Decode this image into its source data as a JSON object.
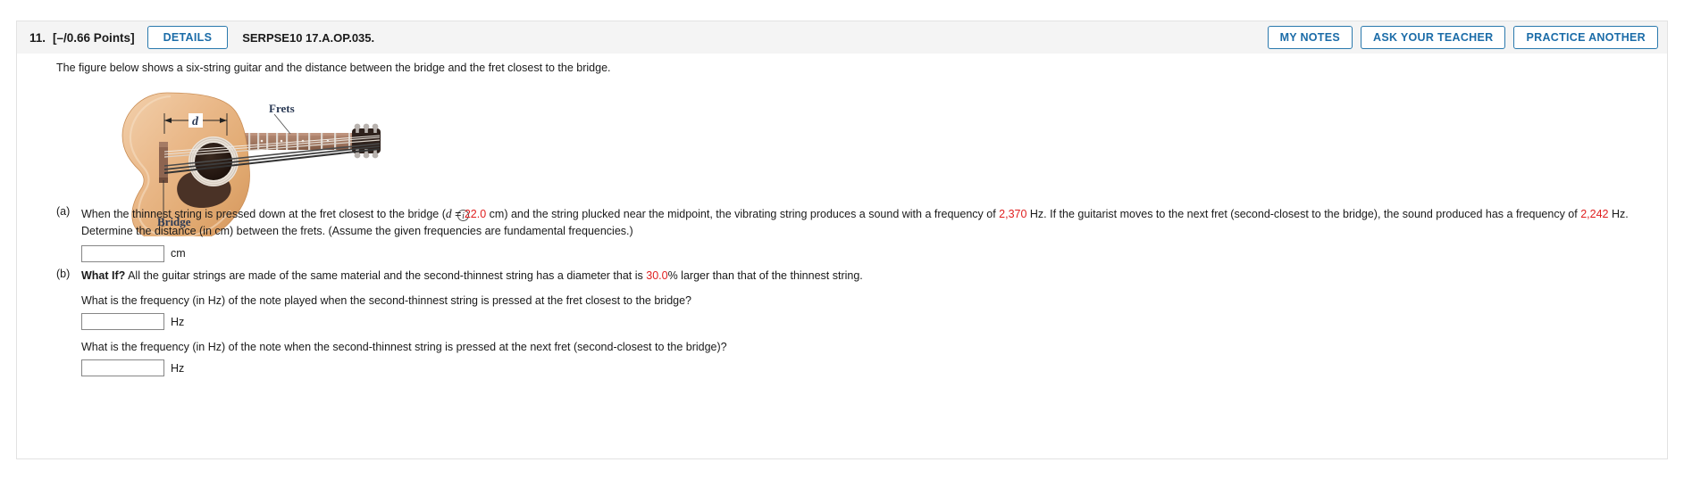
{
  "header": {
    "question_number": "11.",
    "points": "[–/0.66 Points]",
    "details_label": "DETAILS",
    "question_code": "SERPSE10 17.A.OP.035.",
    "my_notes_label": "MY NOTES",
    "ask_teacher_label": "ASK YOUR TEACHER",
    "practice_another_label": "PRACTICE ANOTHER"
  },
  "stem": "The figure below shows a six-string guitar and the distance between the bridge and the fret closest to the bridge.",
  "figure": {
    "label_frets": "Frets",
    "label_bridge": "Bridge",
    "label_d": "d",
    "info_icon": "i"
  },
  "parts": {
    "a": {
      "tag": "(a)",
      "text_1": "When the thinnest string is pressed down at the fret closest to the bridge (",
      "var_d": "d",
      "eq": " = ",
      "d_value": "22.0",
      "text_2": " cm) and the string plucked near the midpoint, the vibrating string produces a sound with a frequency of ",
      "freq_1": "2,370",
      "text_3": " Hz. If the guitarist moves to the next fret (second-closest to the bridge), the sound produced has a frequency of ",
      "freq_2": "2,242",
      "text_4": " Hz. Determine the distance (in cm) between the frets. (Assume the given frequencies are fundamental frequencies.)",
      "input_value": "",
      "input_placeholder": "",
      "unit": "cm"
    },
    "b": {
      "tag": "(b)",
      "what_if": "What If?",
      "text_1": " All the guitar strings are made of the same material and the second-thinnest string has a diameter that is ",
      "pct_value": "30.0",
      "text_2": "% larger than that of the thinnest string.",
      "sub_1": {
        "question": "What is the frequency (in Hz) of the note played when the second-thinnest string is pressed at the fret closest to the bridge?",
        "input_value": "",
        "input_placeholder": "",
        "unit": "Hz"
      },
      "sub_2": {
        "question": "What is the frequency (in Hz) of the note when the second-thinnest string is pressed at the next fret (second-closest to the bridge)?",
        "input_value": "",
        "input_placeholder": "",
        "unit": "Hz"
      }
    }
  },
  "colors": {
    "accent": "#1b6ca8",
    "highlight": "#e02020",
    "header_bg": "#f4f4f4",
    "border": "#e2e2e2"
  }
}
